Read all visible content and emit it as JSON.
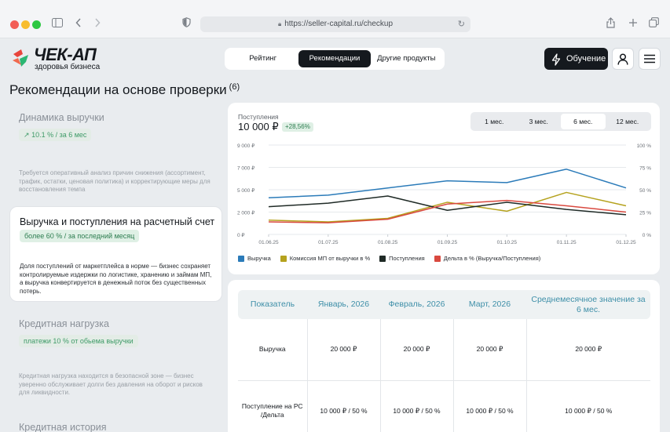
{
  "browser": {
    "url": "https://seller-capital.ru/checkup"
  },
  "header": {
    "logo_title": "ЧЕК-АП",
    "logo_subtitle": "здоровья бизнеса",
    "nav": [
      {
        "label": "Рейтинг",
        "active": false
      },
      {
        "label": "Рекомендации",
        "active": true
      },
      {
        "label": "Другие продукты",
        "active": false
      }
    ],
    "learn_button": "Обучение"
  },
  "page": {
    "title": "Рекомендации на основе проверки",
    "count": "(6)"
  },
  "recommendations": [
    {
      "title": "Динамика выручки",
      "badge": "10.1 % / за 6 мес",
      "desc": "Требуется оперативный анализ причин снижения (ассортимент, трафик, остатки, ценовая политика) и корректирующие меры для восстановления темпа"
    },
    {
      "title": "Выручка и поступления на расчетный счет",
      "badge": "более 60 % / за последний месяц",
      "desc": "Доля поступлений от маркетплейса в норме — бизнес сохраняет контролируемые издержки по логистике, хранению и займам МП, а выручка конвертируется в денежный поток без существенных потерь."
    },
    {
      "title": "Кредитная нагрузка",
      "badge": "платежи 10 % от обьема выручки",
      "desc": "Кредитная нагрузка находится в безопасной зоне — бизнес уверенно обслуживает долги без давления на оборот и рисков для ликвидности."
    },
    {
      "title": "Кредитная история"
    }
  ],
  "kpi": {
    "label": "Поступления",
    "value": "10 000 ₽",
    "delta": "+28,56%"
  },
  "periods": [
    {
      "label": "1 мес.",
      "active": false
    },
    {
      "label": "3 мес.",
      "active": false
    },
    {
      "label": "6 мес.",
      "active": true
    },
    {
      "label": "12 мес.",
      "active": false
    }
  ],
  "chart_data": {
    "type": "line",
    "x": [
      "01.06.25",
      "01.07.25",
      "01.08.25",
      "01.09.25",
      "01.10.25",
      "01.11.25",
      "01.12.25"
    ],
    "y_left_ticks": [
      "0 ₽",
      "2 000 ₽",
      "5 000 ₽",
      "7 000 ₽",
      "9 000 ₽"
    ],
    "y_right_ticks": [
      "0 %",
      "25 %",
      "50 %",
      "75 %",
      "100 %"
    ],
    "ylim": [
      0,
      100
    ],
    "grid": true,
    "legend_position": "bottom",
    "series": [
      {
        "name": "Выручка",
        "color": "#2b7bb9",
        "values": [
          41,
          44,
          52,
          60,
          58,
          73,
          52
        ]
      },
      {
        "name": "Комиссия МП от выручки в %",
        "color": "#b5a21e",
        "values": [
          16,
          14,
          18,
          36,
          26,
          47,
          32
        ]
      },
      {
        "name": "Поступления",
        "color": "#1f2a26",
        "values": [
          31,
          35,
          43,
          27,
          36,
          28,
          22
        ]
      },
      {
        "name": "Дельта в % (Выручка/Поступления)",
        "color": "#d9493f",
        "values": [
          14,
          13,
          17,
          34,
          38,
          32,
          25
        ]
      }
    ]
  },
  "table": {
    "headers": [
      "Показатель",
      "Январь, 2026",
      "Февраль, 2026",
      "Март, 2026",
      "Среднемесячное значение за 6 мес."
    ],
    "rows": [
      [
        "Выручка",
        "20 000 ₽",
        "20 000 ₽",
        "20 000 ₽",
        "20 000 ₽"
      ],
      [
        "Поступление на РС /Дельта",
        "10 000 ₽ / 50 %",
        "10 000 ₽ / 50 %",
        "10 000 ₽ / 50 %",
        "10 000 ₽ / 50 %"
      ]
    ]
  }
}
